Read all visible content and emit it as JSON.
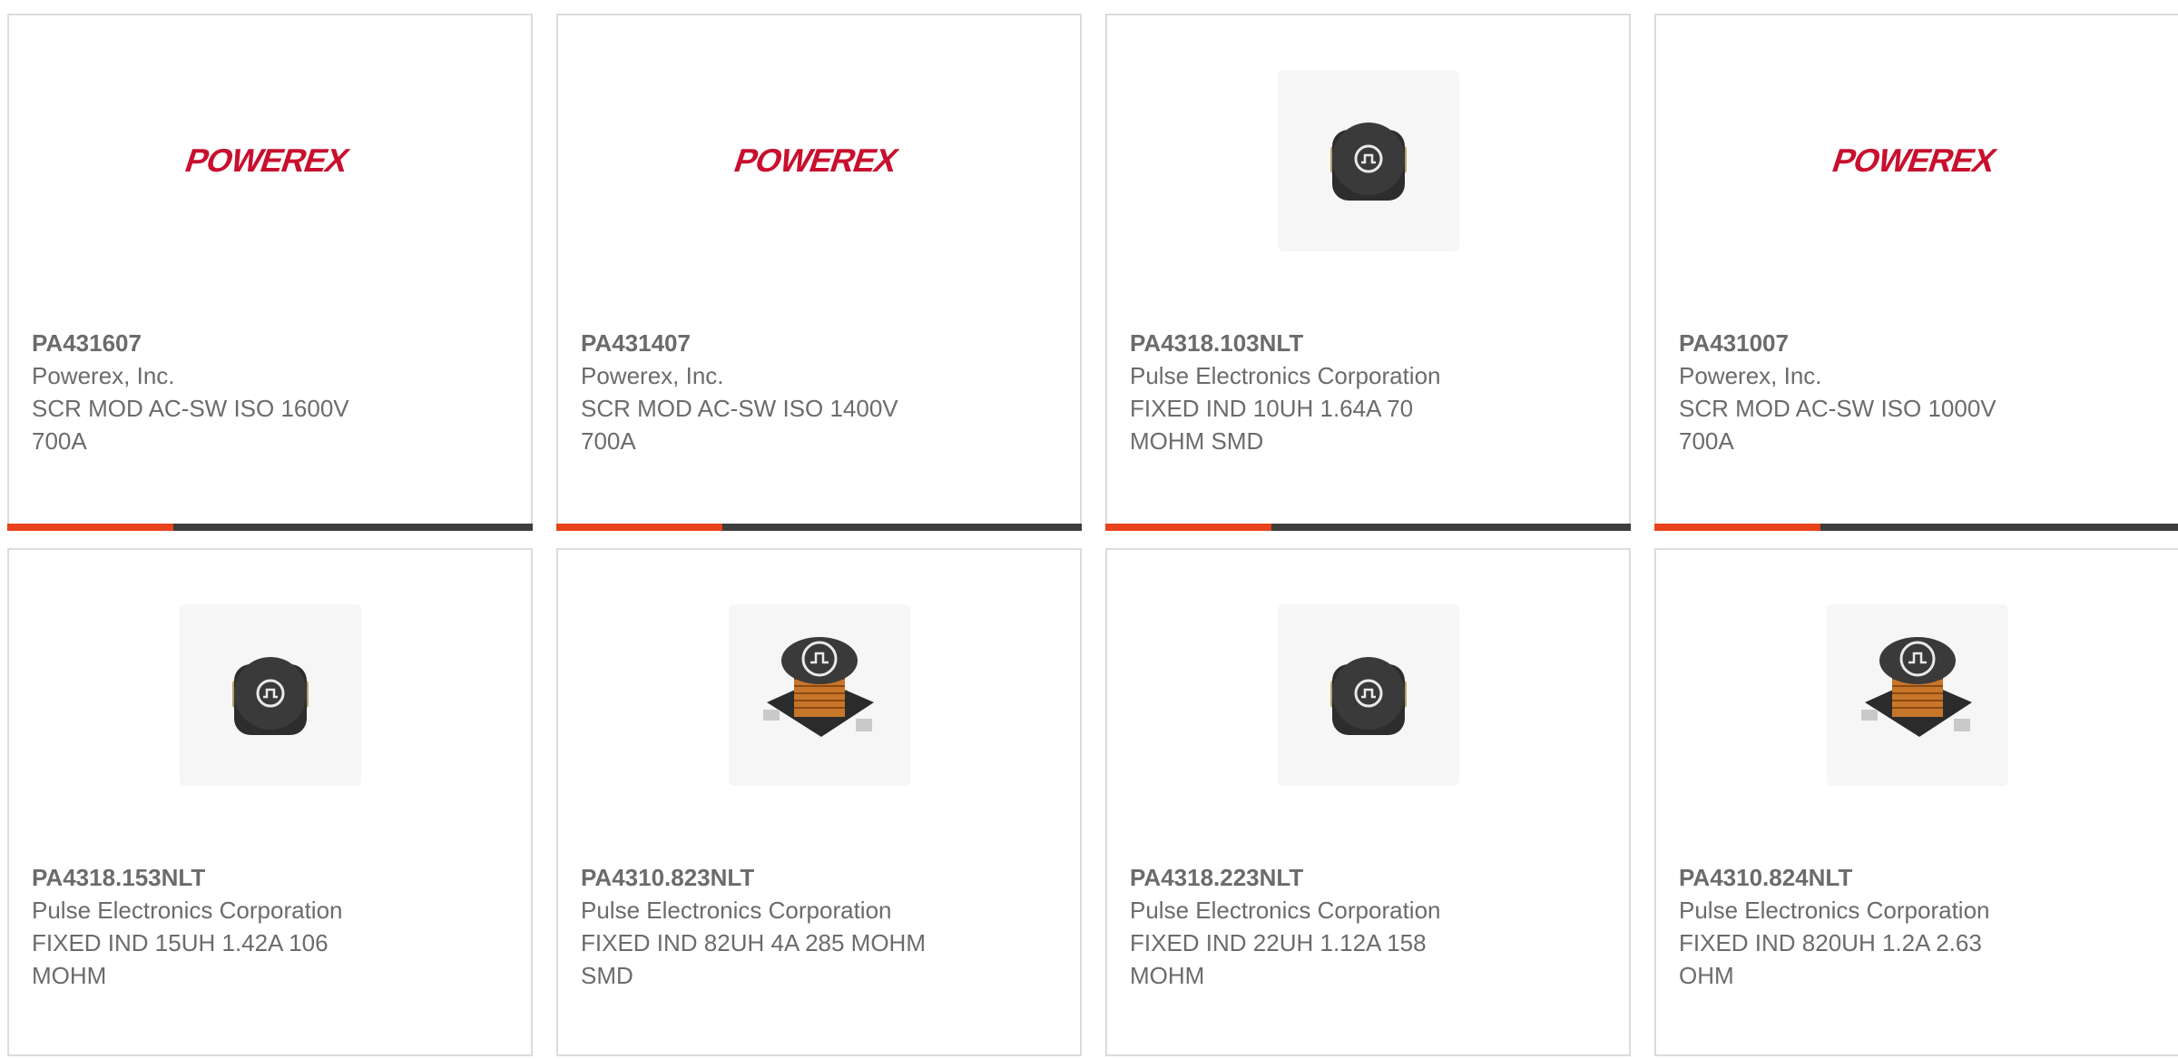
{
  "accent_color": "#e8431a",
  "bar_color": "#3d3d3d",
  "products": [
    {
      "part_number": "PA431607",
      "manufacturer": "Powerex, Inc.",
      "description": "SCR MOD AC-SW ISO 1600V 700A",
      "image": "powerex-logo",
      "logo_text": "POWEREX",
      "logo_color": "#c8102e",
      "has_bar": true
    },
    {
      "part_number": "PA431407",
      "manufacturer": "Powerex, Inc.",
      "description": "SCR MOD AC-SW ISO 1400V 700A",
      "image": "powerex-logo",
      "logo_text": "POWEREX",
      "logo_color": "#c8102e",
      "has_bar": true
    },
    {
      "part_number": "PA4318.103NLT",
      "manufacturer": "Pulse Electronics Corporation",
      "description": "FIXED IND 10UH 1.64A 70 MOHM SMD",
      "image": "inductor-shielded",
      "has_bar": true
    },
    {
      "part_number": "PA431007",
      "manufacturer": "Powerex, Inc.",
      "description": "SCR MOD AC-SW ISO 1000V 700A",
      "image": "powerex-logo",
      "logo_text": "POWEREX",
      "logo_color": "#c8102e",
      "has_bar": true
    },
    {
      "part_number": "PA4318.153NLT",
      "manufacturer": "Pulse Electronics Corporation",
      "description": "FIXED IND 15UH 1.42A 106 MOHM",
      "image": "inductor-shielded",
      "has_bar": false
    },
    {
      "part_number": "PA4310.823NLT",
      "manufacturer": "Pulse Electronics Corporation",
      "description": "FIXED IND 82UH 4A 285 MOHM SMD",
      "image": "inductor-open-coil",
      "has_bar": false
    },
    {
      "part_number": "PA4318.223NLT",
      "manufacturer": "Pulse Electronics Corporation",
      "description": "FIXED IND 22UH 1.12A 158 MOHM",
      "image": "inductor-shielded",
      "has_bar": false
    },
    {
      "part_number": "PA4310.824NLT",
      "manufacturer": "Pulse Electronics Corporation",
      "description": "FIXED IND 820UH 1.2A 2.63 OHM",
      "image": "inductor-open-coil",
      "has_bar": false
    }
  ]
}
